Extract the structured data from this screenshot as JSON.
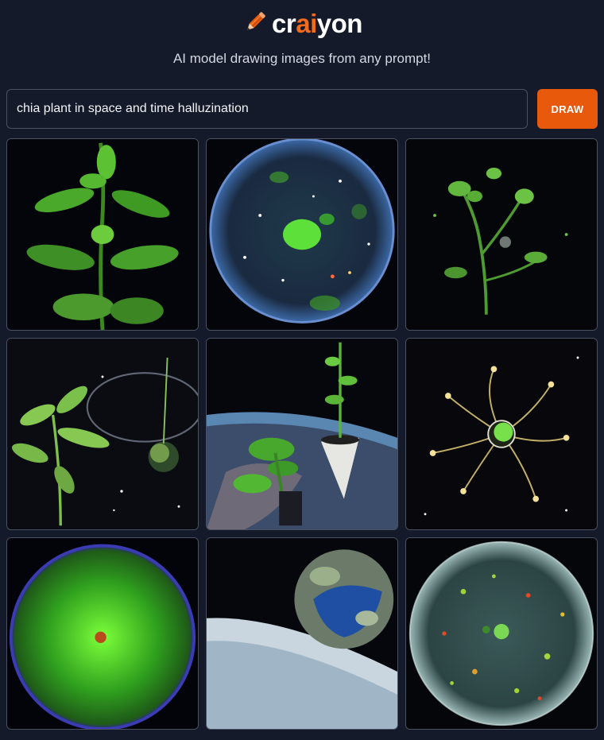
{
  "header": {
    "brand_prefix": "cr",
    "brand_accent": "ai",
    "brand_suffix": "yon",
    "logo_icon": "pencil-icon",
    "tagline": "AI model drawing images from any prompt!"
  },
  "prompt": {
    "value": "chia plant in space and time halluzination",
    "button_label": "DRAW"
  },
  "colors": {
    "background": "#151a2b",
    "accent": "#f26b1d",
    "button": "#e8590c",
    "border": "#4a5163"
  },
  "results": [
    "Plant seedling on black background",
    "Circular starfield with green glow",
    "Sprouting stem against dark space",
    "Plant beside orbit ring in space",
    "Potted plant over Earth horizon",
    "Glowing neural orb with tendrils",
    "Green textured sphere",
    "Earth-like planet above clouds",
    "Translucent sphere with green specks"
  ]
}
